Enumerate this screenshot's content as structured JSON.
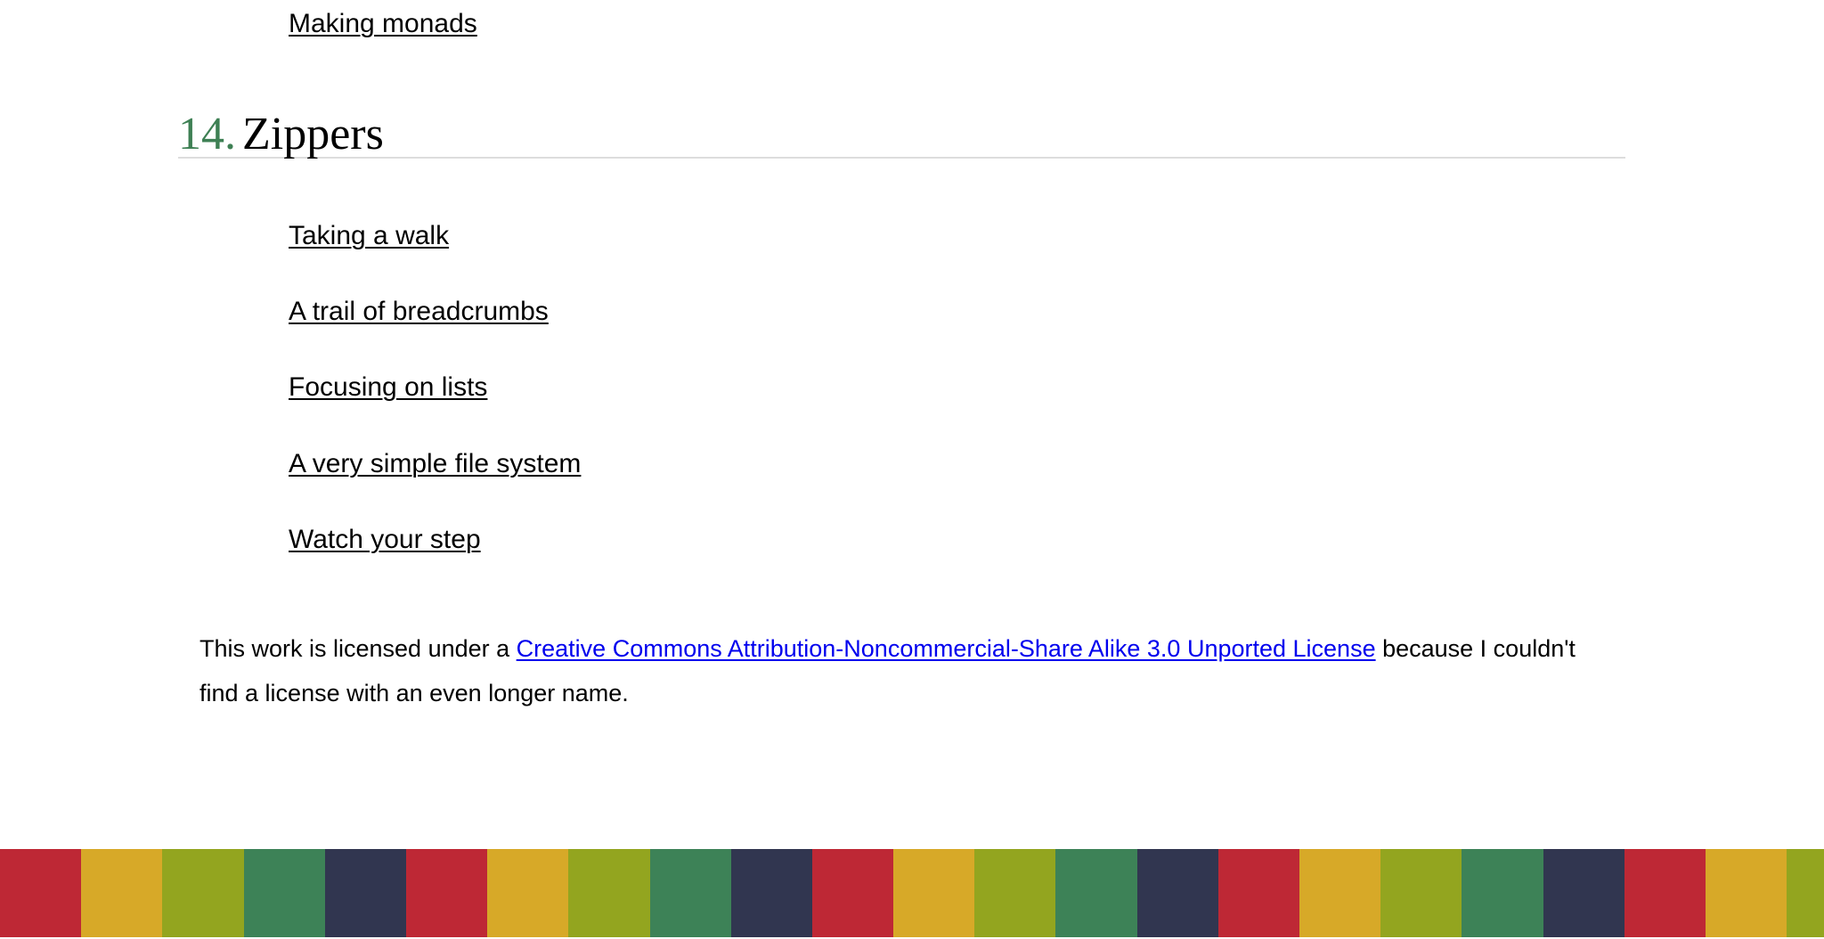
{
  "previous_section": {
    "link_label": "Making monads"
  },
  "chapter": {
    "number": "14.",
    "title": "Zippers",
    "number_color": "#3e8054"
  },
  "sections": [
    {
      "label": "Taking a walk"
    },
    {
      "label": "A trail of breadcrumbs"
    },
    {
      "label": "Focusing on lists"
    },
    {
      "label": "A very simple file system"
    },
    {
      "label": "Watch your step"
    }
  ],
  "license": {
    "prefix": "This work is licensed under a ",
    "link_text": "Creative Commons Attribution-Noncommercial-Share Alike 3.0 Unported License",
    "suffix": " because I couldn't find a license with an even longer name."
  },
  "footer_stripe": {
    "colors": [
      "#be2835",
      "#d7a928",
      "#93a51f",
      "#3d8257",
      "#313650"
    ]
  }
}
